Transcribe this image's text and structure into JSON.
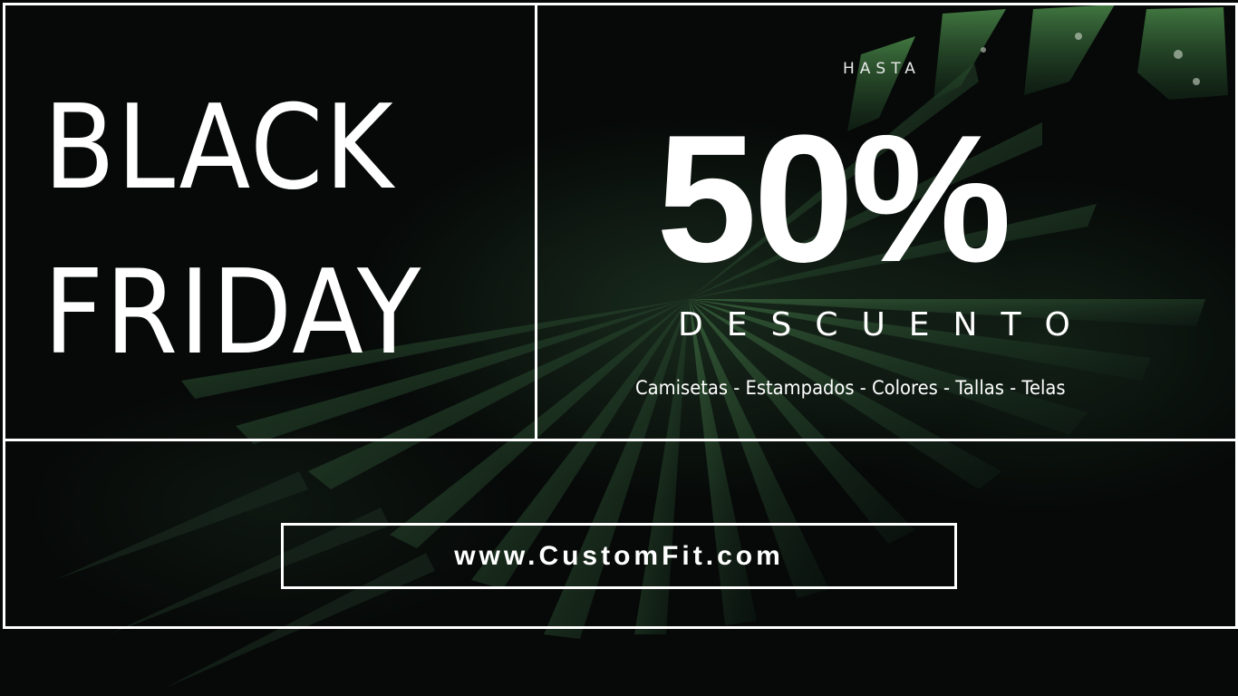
{
  "headline": {
    "line1": "BLACK",
    "line2": "FRIDAY"
  },
  "offer": {
    "prefix": "HASTA",
    "amount": "50%",
    "label": "DESCUENTO",
    "categories": "Camisetas - Estampados - Colores - Tallas - Telas"
  },
  "website": {
    "url": "www.CustomFit.com"
  },
  "colors": {
    "background": "#060908",
    "foliage": "#2f5a34",
    "text": "#ffffff",
    "frame": "#ffffff"
  },
  "icons": {
    "background_image": "palm-leaves-image"
  }
}
